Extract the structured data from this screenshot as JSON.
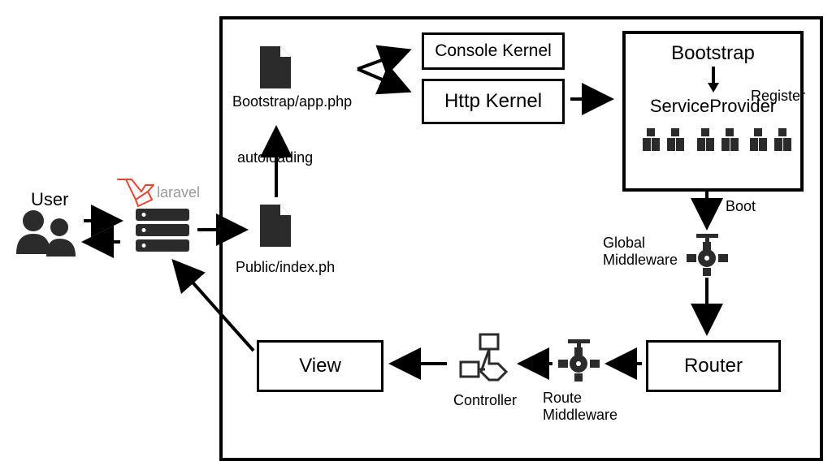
{
  "labels": {
    "user": "User",
    "laravel": "laravel",
    "bootstrap_app": "Bootstrap/app.php",
    "autoloading": "autoloading",
    "public_index": "Public/index.ph",
    "console_kernel": "Console Kernel",
    "http_kernel": "Http Kernel",
    "bootstrap": "Bootstrap",
    "register": "Register",
    "service_provider": "ServiceProvider",
    "boot": "Boot",
    "global_middleware": "Global\nMiddleware",
    "router": "Router",
    "route_middleware": "Route\nMiddleware",
    "controller": "Controller",
    "view": "View"
  }
}
